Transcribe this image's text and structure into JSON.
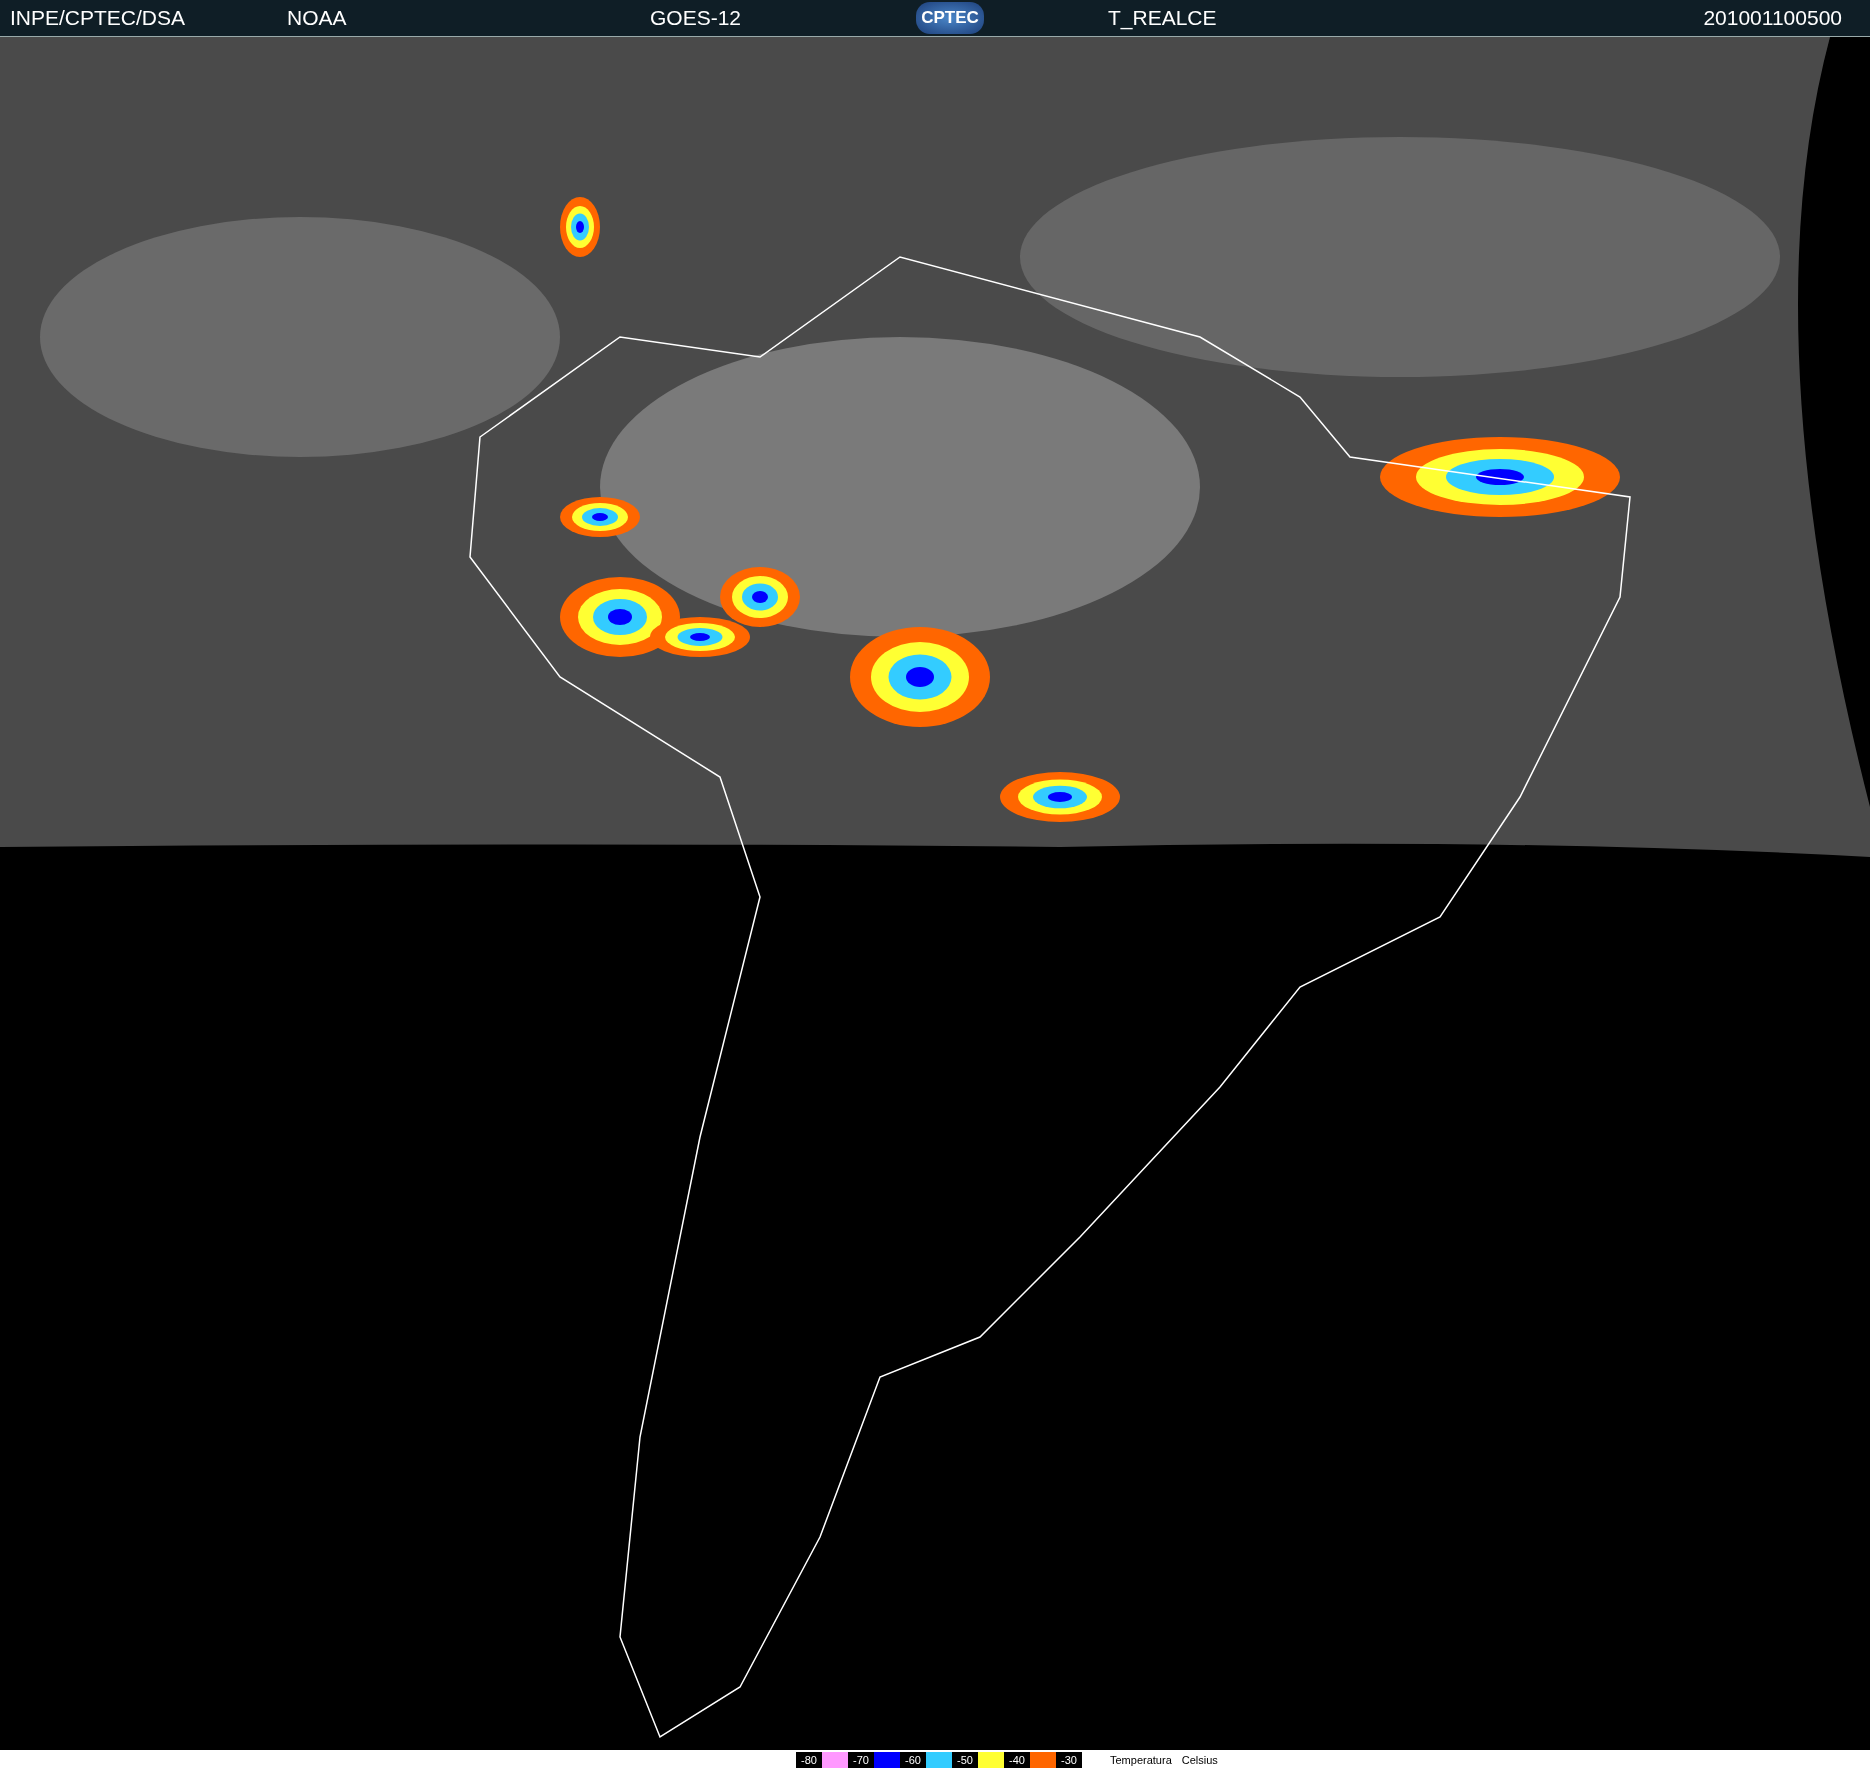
{
  "header": {
    "agency": "INPE/CPTEC/DSA",
    "source": "NOAA",
    "satellite": "GOES-12",
    "logo": "CPTEC",
    "product": "T_REALCE",
    "timestamp": "201001100500"
  },
  "legend": {
    "steps": [
      {
        "label": "-80",
        "color": "#ff99ff"
      },
      {
        "label": "-70",
        "color": "#0000ff"
      },
      {
        "label": "-60",
        "color": "#33ccff"
      },
      {
        "label": "-50",
        "color": "#ffff33"
      },
      {
        "label": "-40",
        "color": "#ff6600"
      },
      {
        "label": "-30"
      }
    ],
    "title": "Temperatura",
    "unit": "Celsius"
  }
}
